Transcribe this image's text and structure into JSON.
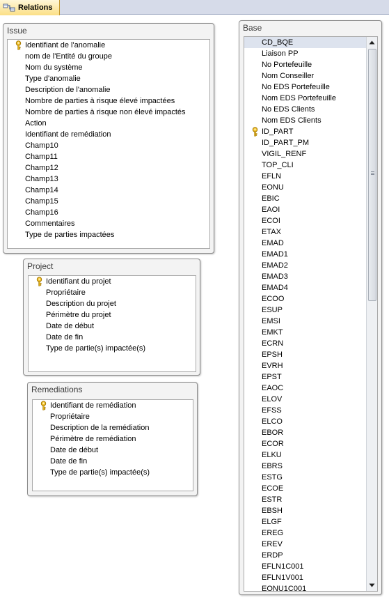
{
  "tab": {
    "label": "Relations",
    "icon": "relationships-icon"
  },
  "tables": {
    "issue": {
      "title": "Issue",
      "fields": [
        {
          "label": "Identifiant de l'anomalie",
          "key": true
        },
        {
          "label": "nom de l'Entité du groupe"
        },
        {
          "label": "Nom du système"
        },
        {
          "label": "Type d'anomalie"
        },
        {
          "label": "Description de l'anomalie"
        },
        {
          "label": "Nombre de parties à risque élevé impactées"
        },
        {
          "label": "Nombre de parties à risque non élevé impactés"
        },
        {
          "label": "Action"
        },
        {
          "label": "Identifiant de remédiation"
        },
        {
          "label": "Champ10"
        },
        {
          "label": "Champ11"
        },
        {
          "label": "Champ12"
        },
        {
          "label": "Champ13"
        },
        {
          "label": "Champ14"
        },
        {
          "label": "Champ15"
        },
        {
          "label": "Champ16"
        },
        {
          "label": "Commentaires"
        },
        {
          "label": "Type de parties impactées"
        }
      ]
    },
    "project": {
      "title": "Project",
      "fields": [
        {
          "label": "Identifiant du projet",
          "key": true
        },
        {
          "label": "Propriétaire"
        },
        {
          "label": "Description du projet"
        },
        {
          "label": "Périmètre du projet"
        },
        {
          "label": "Date de début"
        },
        {
          "label": "Date de fin"
        },
        {
          "label": "Type de partie(s) impactée(s)"
        }
      ]
    },
    "remediations": {
      "title": "Remediations",
      "fields": [
        {
          "label": "Identifiant de remédiation",
          "key": true
        },
        {
          "label": "Propriétaire"
        },
        {
          "label": "Description de la remédiation"
        },
        {
          "label": "Périmètre de remédiation"
        },
        {
          "label": "Date de début"
        },
        {
          "label": "Date de fin"
        },
        {
          "label": "Type de partie(s) impactée(s)"
        }
      ]
    },
    "base": {
      "title": "Base",
      "fields": [
        {
          "label": "CD_BQE",
          "selected": true
        },
        {
          "label": "Liaison PP"
        },
        {
          "label": "No Portefeuille"
        },
        {
          "label": "Nom Conseiller"
        },
        {
          "label": "No EDS Portefeuille"
        },
        {
          "label": "Nom EDS Portefeuille"
        },
        {
          "label": "No EDS Clients"
        },
        {
          "label": "Nom EDS Clients"
        },
        {
          "label": "ID_PART",
          "key": true
        },
        {
          "label": "ID_PART_PM"
        },
        {
          "label": "VIGIL_RENF"
        },
        {
          "label": "TOP_CLI"
        },
        {
          "label": "EFLN"
        },
        {
          "label": "EONU"
        },
        {
          "label": "EBIC"
        },
        {
          "label": "EAOI"
        },
        {
          "label": "ECOI"
        },
        {
          "label": "ETAX"
        },
        {
          "label": "EMAD"
        },
        {
          "label": "EMAD1"
        },
        {
          "label": "EMAD2"
        },
        {
          "label": "EMAD3"
        },
        {
          "label": "EMAD4"
        },
        {
          "label": "ECOO"
        },
        {
          "label": "ESUP"
        },
        {
          "label": "EMSI"
        },
        {
          "label": "EMKT"
        },
        {
          "label": "ECRN"
        },
        {
          "label": "EPSH"
        },
        {
          "label": "EVRH"
        },
        {
          "label": "EPST"
        },
        {
          "label": "EAOC"
        },
        {
          "label": "ELOV"
        },
        {
          "label": "EFSS"
        },
        {
          "label": "ELCO"
        },
        {
          "label": "EBOR"
        },
        {
          "label": "ECOR"
        },
        {
          "label": "ELKU"
        },
        {
          "label": "EBRS"
        },
        {
          "label": "ESTG"
        },
        {
          "label": "ECOE"
        },
        {
          "label": "ESTR"
        },
        {
          "label": "EBSH"
        },
        {
          "label": "ELGF"
        },
        {
          "label": "EREG"
        },
        {
          "label": "EREV"
        },
        {
          "label": "ERDP"
        },
        {
          "label": "EFLN1C001"
        },
        {
          "label": "EFLN1V001"
        },
        {
          "label": "EONU1C001"
        }
      ]
    }
  },
  "icons": {
    "primary_key": "key-icon",
    "scroll_up": "scroll-up-arrow-icon",
    "scroll_down": "scroll-down-arrow-icon"
  },
  "colors": {
    "tab_active": "#fbdf86",
    "tabstrip": "#d6dbe9",
    "selection": "#dde3ee",
    "key_gold": "#d9a400"
  }
}
